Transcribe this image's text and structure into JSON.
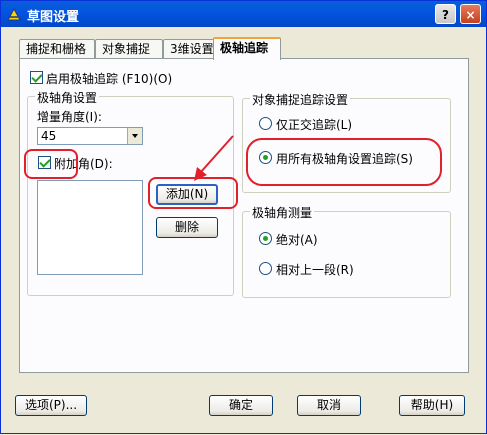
{
  "window": {
    "title": "草图设置",
    "help_label": "?",
    "close_label": "×",
    "icon": "app-icon"
  },
  "tabs": [
    {
      "label": "捕捉和栅格",
      "active": false
    },
    {
      "label": "对象捕捉",
      "active": false
    },
    {
      "label": "3维设置",
      "active": false
    },
    {
      "label": "极轴追踪",
      "active": true
    }
  ],
  "enable_polar": {
    "label": "启用极轴追踪 (F10)(O)",
    "checked": true
  },
  "polar_settings": {
    "group_title": "极轴角设置",
    "increment_label": "增量角度(I):",
    "increment_value": "45",
    "additional": {
      "label": "附加角(D):",
      "checked": true
    },
    "add_button": "添加(N)",
    "delete_button": "删除"
  },
  "snap_tracking": {
    "group_title": "对象捕捉追踪设置",
    "options": [
      {
        "label": "仅正交追踪(L)",
        "selected": false
      },
      {
        "label": "用所有极轴角设置追踪(S)",
        "selected": true
      }
    ]
  },
  "measurement": {
    "group_title": "极轴角测量",
    "options": [
      {
        "label": "绝对(A)",
        "selected": true
      },
      {
        "label": "相对上一段(R)",
        "selected": false
      }
    ]
  },
  "footer": {
    "options_button": "选项(P)...",
    "ok_button": "确定",
    "cancel_button": "取消",
    "help_button": "帮助(H)"
  },
  "colors": {
    "titlebar": "#0355e0",
    "annotation": "#e0202a",
    "check": "#21a121",
    "tab_highlight": "#f1a33c"
  }
}
